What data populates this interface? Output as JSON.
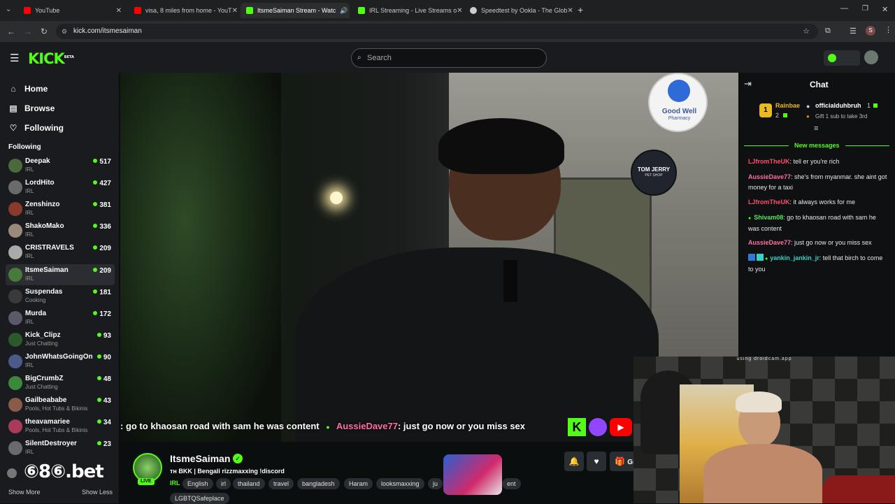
{
  "browser": {
    "tabs": [
      {
        "title": "YouTube",
        "fav": "#ff0000"
      },
      {
        "title": "visa, 8 miles from home - YouT",
        "fav": "#ff0000"
      },
      {
        "title": "ItsmeSaiman Stream - Watc",
        "fav": "#53fc18"
      },
      {
        "title": "IRL Streaming - Live Streams o",
        "fav": "#53fc18"
      },
      {
        "title": "Speedtest by Ookla - The Glob",
        "fav": "#cccccc"
      }
    ],
    "url": "kick.com/itsmesaiman",
    "profile_initial": "S"
  },
  "header": {
    "logo": "KICK",
    "logo_badge": "BETA",
    "search_placeholder": "Search"
  },
  "sidebar": {
    "nav": [
      {
        "label": "Home",
        "icon": "home-icon"
      },
      {
        "label": "Browse",
        "icon": "browse-icon"
      },
      {
        "label": "Following",
        "icon": "heart-icon"
      }
    ],
    "following_heading": "Following",
    "channels": [
      {
        "name": "Deepak",
        "category": "IRL",
        "viewers": "517",
        "color": "#4a6a3a"
      },
      {
        "name": "LordHito",
        "category": "IRL",
        "viewers": "427",
        "color": "#6a6a6a"
      },
      {
        "name": "Zenshinzo",
        "category": "IRL",
        "viewers": "381",
        "color": "#8a3a2a"
      },
      {
        "name": "ShakoMako",
        "category": "IRL",
        "viewers": "336",
        "color": "#9a8a7a"
      },
      {
        "name": "CRISTRAVELS",
        "category": "IRL",
        "viewers": "209",
        "color": "#aaaaaa"
      },
      {
        "name": "ItsmeSaiman",
        "category": "IRL",
        "viewers": "209",
        "color": "#4a7a3a"
      },
      {
        "name": "Suspendas",
        "category": "Cooking",
        "viewers": "181",
        "color": "#3a3a3a"
      },
      {
        "name": "Murda",
        "category": "IRL",
        "viewers": "172",
        "color": "#5a5a6a"
      },
      {
        "name": "Kick_Clipz",
        "category": "Just Chatting",
        "viewers": "93",
        "color": "#2a5a2a"
      },
      {
        "name": "JohnWhatsGoingOn",
        "category": "IRL",
        "viewers": "90",
        "color": "#4a5a8a"
      },
      {
        "name": "BigCrumbZ",
        "category": "Just Chatting",
        "viewers": "48",
        "color": "#3a8a3a"
      },
      {
        "name": "Gailbeababe",
        "category": "Pools, Hot Tubs & Bikinis",
        "viewers": "43",
        "color": "#8a5a4a"
      },
      {
        "name": "theavamariee",
        "category": "Pools, Hot Tubs & Bikinis",
        "viewers": "34",
        "color": "#aa3a5a"
      },
      {
        "name": "SilentDestroyer",
        "category": "IRL",
        "viewers": "23",
        "color": "#6a6a6a"
      }
    ],
    "show_more": "Show More",
    "show_less": "Show Less",
    "overlay_ad": "⑥8⑥.bet"
  },
  "video": {
    "subtitle_pre": ": go to khaosan road with sam he was content",
    "subtitle_user": "AussieDave77",
    "subtitle_post": ": just go now or you miss sex",
    "sign_text": "Good Well",
    "sign_sub": "Pharmacy",
    "sign2_text": "TOM JERRY",
    "sign2_sub": "PET SHOP"
  },
  "chat": {
    "title": "Chat",
    "pinned": {
      "rank1_user": "Rainbae",
      "rank1_count": "1",
      "rank2_user": "officialduhbruh",
      "rank2_count": "1",
      "rank3_count": "2",
      "note": "Gift 1 sub to take 3rd"
    },
    "new_messages_label": "New messages",
    "messages": [
      {
        "user": "LJfromTheUK",
        "color": "#ff4d6d",
        "text": ": tell er you're rich"
      },
      {
        "user": "AussieDave77",
        "color": "#ff6fa5",
        "text": ": she's from myanmar. she aint got money for a taxi"
      },
      {
        "user": "LJfromTheUK",
        "color": "#ff4d6d",
        "text": ": it always works for me"
      },
      {
        "user": "Shivam08",
        "color": "#5ce65c",
        "text": ": go to khaosan road with sam he was content"
      },
      {
        "user": "AussieDave77",
        "color": "#ff6fa5",
        "text": ": just go now or you miss sex"
      },
      {
        "user": "yankin_jankin_jr",
        "color": "#35d3c4",
        "text": ": tell that birch to come to you"
      }
    ]
  },
  "webcam": {
    "watermark": "using droidcam.app"
  },
  "stream": {
    "streamer": "ItsmeSaiman",
    "live_label": "LIVE",
    "title": "ᴛʜ BKK | Bengali rizzmaxxing !discord",
    "category": "IRL",
    "tags": [
      "English",
      "irl",
      "thailand",
      "travel",
      "bangladesh",
      "Haram",
      "looksmaxxing",
      "ju",
      "ent"
    ],
    "tag_row2": "LGBTQSafeplace",
    "gift_label": "Gi"
  },
  "colors": {
    "kick_green": "#53fc18",
    "panel": "#191b1f",
    "background": "#0b0e0f"
  }
}
